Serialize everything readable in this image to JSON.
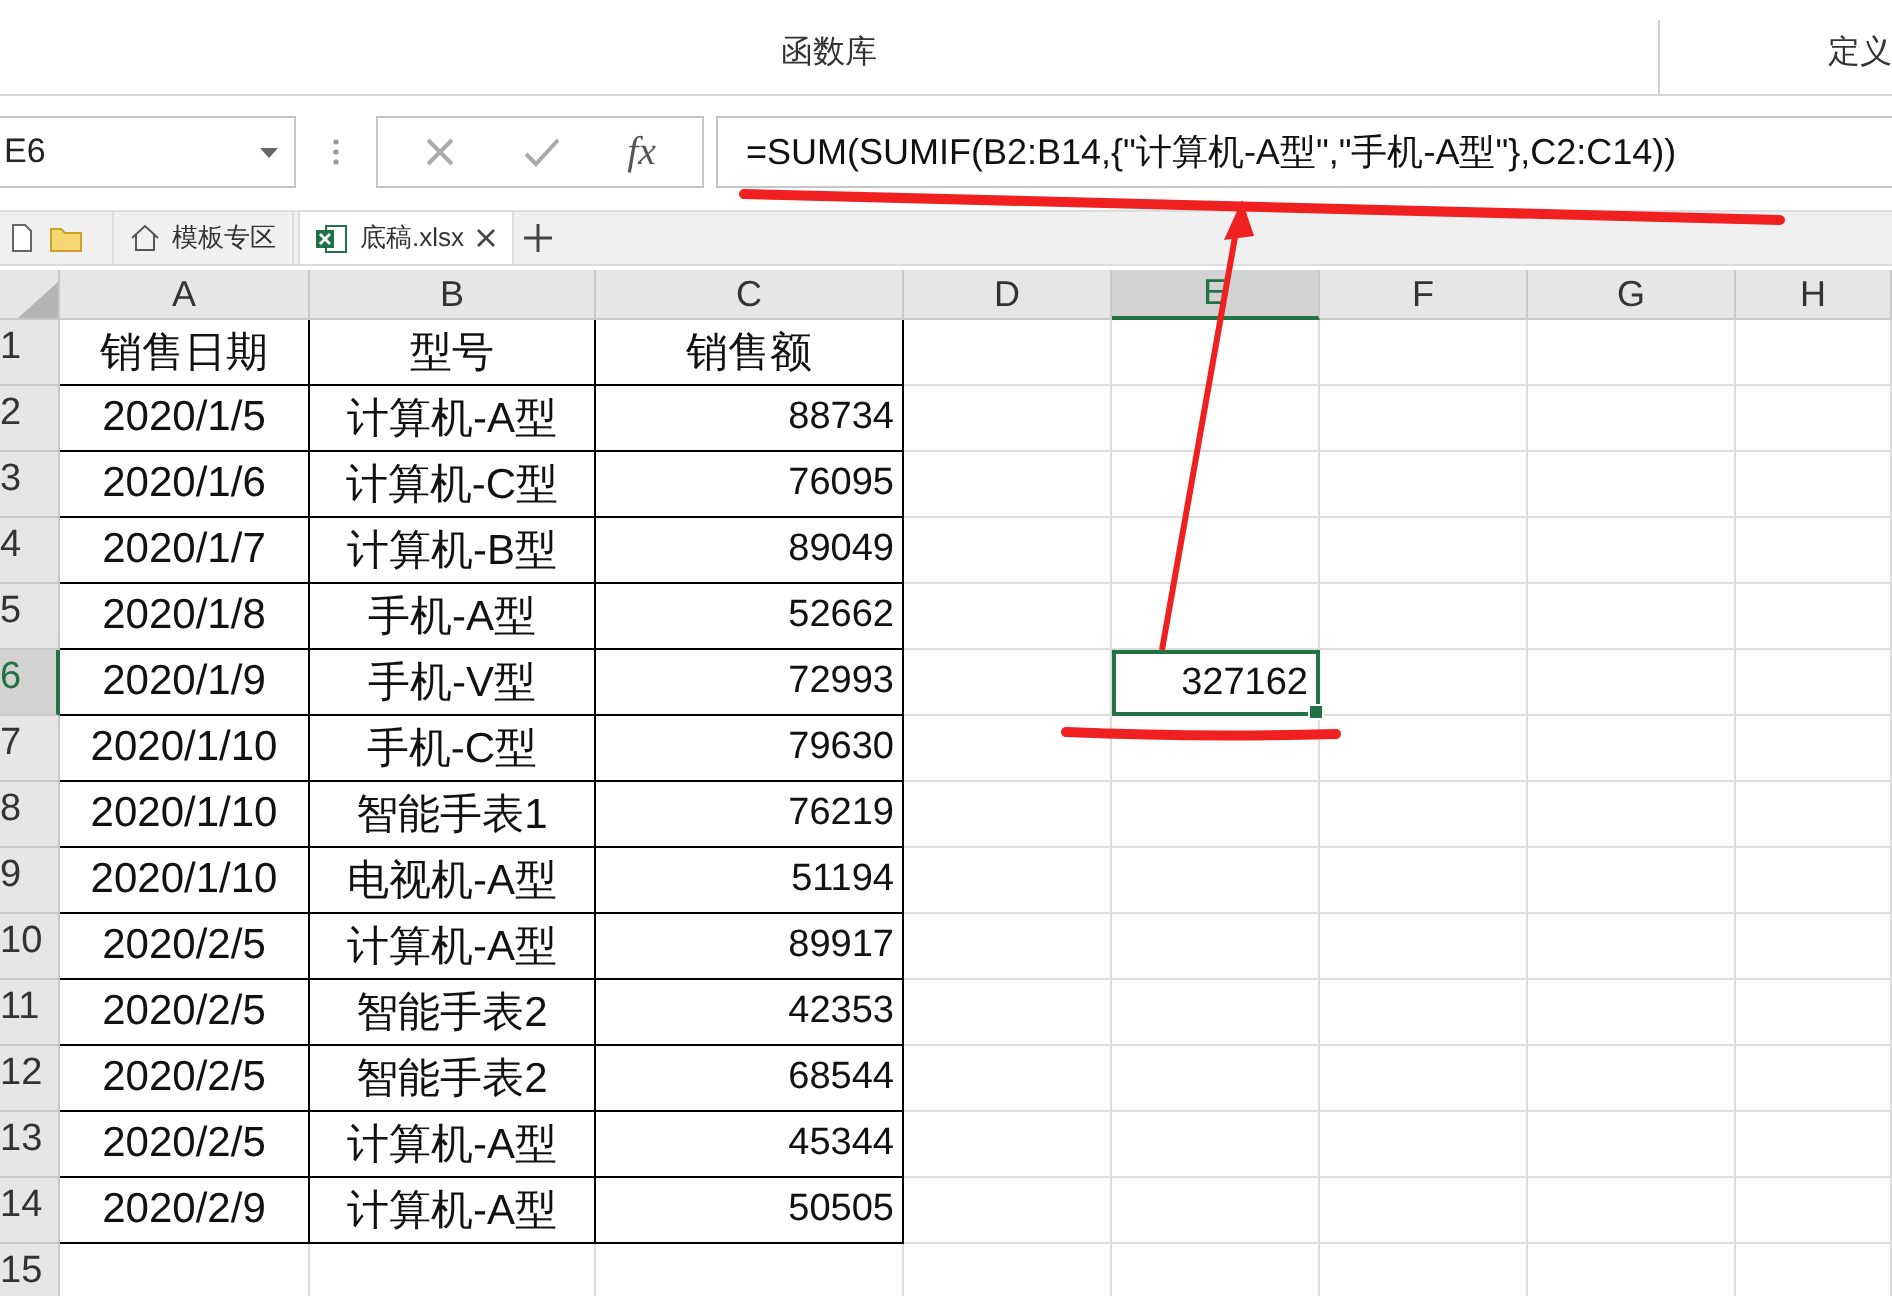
{
  "ribbon": {
    "group_label": "函数库",
    "cut_label": "定义"
  },
  "name_box": {
    "value": "E6"
  },
  "formula_bar": {
    "fx_label": "fx",
    "formula": "=SUM(SUMIF(B2:B14,{\"计算机-A型\",\"手机-A型\"},C2:C14))"
  },
  "sheet_tabs": [
    {
      "label": "模板专区",
      "kind": "template",
      "selected": false
    },
    {
      "label": "底稿.xlsx",
      "kind": "workbook",
      "selected": true
    }
  ],
  "columns": [
    {
      "label": "A",
      "selected": false
    },
    {
      "label": "B",
      "selected": false
    },
    {
      "label": "C",
      "selected": false
    },
    {
      "label": "D",
      "selected": false
    },
    {
      "label": "E",
      "selected": true
    },
    {
      "label": "F",
      "selected": false
    },
    {
      "label": "G",
      "selected": false
    },
    {
      "label": "H",
      "selected": false
    }
  ],
  "rows": [
    {
      "number": "1",
      "selected": false,
      "kind": "header",
      "cells": [
        "销售日期",
        "型号",
        "销售额"
      ]
    },
    {
      "number": "2",
      "selected": false,
      "kind": "data",
      "cells": [
        "2020/1/5",
        "计算机-A型",
        "88734"
      ]
    },
    {
      "number": "3",
      "selected": false,
      "kind": "data",
      "cells": [
        "2020/1/6",
        "计算机-C型",
        "76095"
      ]
    },
    {
      "number": "4",
      "selected": false,
      "kind": "data",
      "cells": [
        "2020/1/7",
        "计算机-B型",
        "89049"
      ]
    },
    {
      "number": "5",
      "selected": false,
      "kind": "data",
      "cells": [
        "2020/1/8",
        "手机-A型",
        "52662"
      ]
    },
    {
      "number": "6",
      "selected": true,
      "kind": "data",
      "cells": [
        "2020/1/9",
        "手机-V型",
        "72993"
      ],
      "active_value": "327162"
    },
    {
      "number": "7",
      "selected": false,
      "kind": "data",
      "cells": [
        "2020/1/10",
        "手机-C型",
        "79630"
      ]
    },
    {
      "number": "8",
      "selected": false,
      "kind": "data",
      "cells": [
        "2020/1/10",
        "智能手表1",
        "76219"
      ]
    },
    {
      "number": "9",
      "selected": false,
      "kind": "data",
      "cells": [
        "2020/1/10",
        "电视机-A型",
        "51194"
      ]
    },
    {
      "number": "10",
      "selected": false,
      "kind": "data",
      "cells": [
        "2020/2/5",
        "计算机-A型",
        "89917"
      ]
    },
    {
      "number": "11",
      "selected": false,
      "kind": "data",
      "cells": [
        "2020/2/5",
        "智能手表2",
        "42353"
      ]
    },
    {
      "number": "12",
      "selected": false,
      "kind": "data",
      "cells": [
        "2020/2/5",
        "智能手表2",
        "68544"
      ]
    },
    {
      "number": "13",
      "selected": false,
      "kind": "data",
      "cells": [
        "2020/2/5",
        "计算机-A型",
        "45344"
      ]
    },
    {
      "number": "14",
      "selected": false,
      "kind": "data",
      "cells": [
        "2020/2/9",
        "计算机-A型",
        "50505"
      ]
    },
    {
      "number": "15",
      "selected": false,
      "kind": "empty"
    }
  ]
}
